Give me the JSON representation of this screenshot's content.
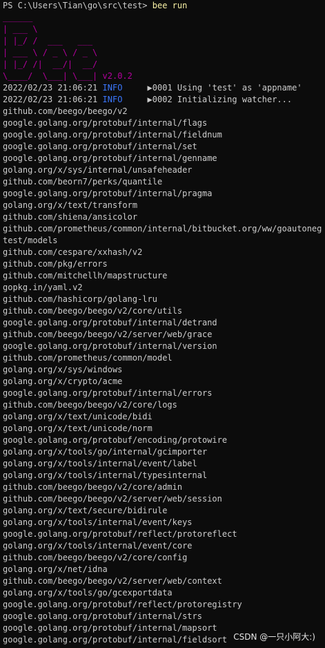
{
  "prompt": {
    "path": "PS C:\\Users\\Tian\\go\\src\\test>",
    "command": "bee run"
  },
  "logo": {
    "lines": [
      "______",
      "| ___ \\",
      "| |_/ /  ___   ___",
      "| ___ \\ / _ \\ / _ \\",
      "| |_/ /|  __/|  __/",
      "\\____/  \\___| \\___|"
    ],
    "version": "v2.0.2"
  },
  "logs": [
    {
      "timestamp": "2022/02/23 21:06:21",
      "level": "INFO",
      "code": "0001",
      "message": "Using 'test' as 'appname'"
    },
    {
      "timestamp": "2022/02/23 21:06:21",
      "level": "INFO",
      "code": "0002",
      "message": "Initializing watcher..."
    }
  ],
  "packages": [
    "github.com/beego/beego/v2",
    "google.golang.org/protobuf/internal/flags",
    "google.golang.org/protobuf/internal/fieldnum",
    "google.golang.org/protobuf/internal/set",
    "google.golang.org/protobuf/internal/genname",
    "golang.org/x/sys/internal/unsafeheader",
    "github.com/beorn7/perks/quantile",
    "google.golang.org/protobuf/internal/pragma",
    "golang.org/x/text/transform",
    "github.com/shiena/ansicolor",
    "github.com/prometheus/common/internal/bitbucket.org/ww/goautoneg",
    "test/models",
    "github.com/cespare/xxhash/v2",
    "github.com/pkg/errors",
    "github.com/mitchellh/mapstructure",
    "gopkg.in/yaml.v2",
    "github.com/hashicorp/golang-lru",
    "github.com/beego/beego/v2/core/utils",
    "google.golang.org/protobuf/internal/detrand",
    "github.com/beego/beego/v2/server/web/grace",
    "google.golang.org/protobuf/internal/version",
    "github.com/prometheus/common/model",
    "golang.org/x/sys/windows",
    "golang.org/x/crypto/acme",
    "google.golang.org/protobuf/internal/errors",
    "github.com/beego/beego/v2/core/logs",
    "golang.org/x/text/unicode/bidi",
    "golang.org/x/text/unicode/norm",
    "google.golang.org/protobuf/encoding/protowire",
    "golang.org/x/tools/go/internal/gcimporter",
    "golang.org/x/tools/internal/event/label",
    "golang.org/x/tools/internal/typesinternal",
    "github.com/beego/beego/v2/core/admin",
    "github.com/beego/beego/v2/server/web/session",
    "golang.org/x/text/secure/bidirule",
    "golang.org/x/tools/internal/event/keys",
    "google.golang.org/protobuf/reflect/protoreflect",
    "golang.org/x/tools/internal/event/core",
    "github.com/beego/beego/v2/core/config",
    "golang.org/x/net/idna",
    "github.com/beego/beego/v2/server/web/context",
    "golang.org/x/tools/go/gcexportdata",
    "google.golang.org/protobuf/reflect/protoregistry",
    "google.golang.org/protobuf/internal/strs",
    "google.golang.org/protobuf/internal/mapsort",
    "google.golang.org/protobuf/internal/fieldsort"
  ],
  "watermark": "CSDN @一只小阿大:)",
  "colors": {
    "background": "#0c0c0c",
    "text": "#cccccc",
    "command": "#f9f1a5",
    "logo": "#b4009e",
    "info": "#3b78ff"
  }
}
